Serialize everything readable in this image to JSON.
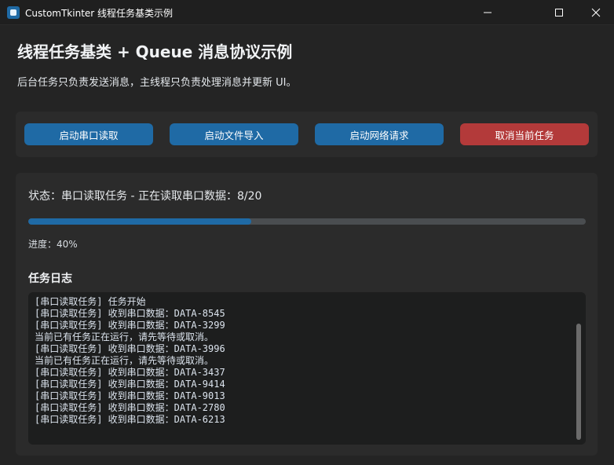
{
  "window": {
    "title": "CustomTkinter 线程任务基类示例",
    "controls": [
      "minimize-icon",
      "maximize-icon",
      "close-icon"
    ]
  },
  "header": {
    "title": "线程任务基类 + Queue 消息协议示例",
    "subtitle": "后台任务只负责发送消息，主线程只负责处理消息并更新 UI。"
  },
  "toolbar": {
    "buttons": [
      {
        "label": "启动串口读取",
        "color": "#1f6aa5"
      },
      {
        "label": "启动文件导入",
        "color": "#1f6aa5"
      },
      {
        "label": "启动网络请求",
        "color": "#1f6aa5"
      },
      {
        "label": "取消当前任务",
        "color": "#b33a3a"
      }
    ]
  },
  "status": {
    "text": "状态：串口读取任务 - 正在读取串口数据：8/20"
  },
  "progress": {
    "value": 0.4,
    "label": "进度：40%",
    "color": "#1f6aa5"
  },
  "log": {
    "heading": "任务日志",
    "lines": [
      "[串口读取任务] 任务开始",
      "[串口读取任务] 收到串口数据：DATA-8545",
      "[串口读取任务] 收到串口数据：DATA-3299",
      "当前已有任务正在运行，请先等待或取消。",
      "[串口读取任务] 收到串口数据：DATA-3996",
      "当前已有任务正在运行，请先等待或取消。",
      "[串口读取任务] 收到串口数据：DATA-3437",
      "[串口读取任务] 收到串口数据：DATA-9414",
      "[串口读取任务] 收到串口数据：DATA-9013",
      "[串口读取任务] 收到串口数据：DATA-2780",
      "[串口读取任务] 收到串口数据：DATA-6213"
    ]
  }
}
